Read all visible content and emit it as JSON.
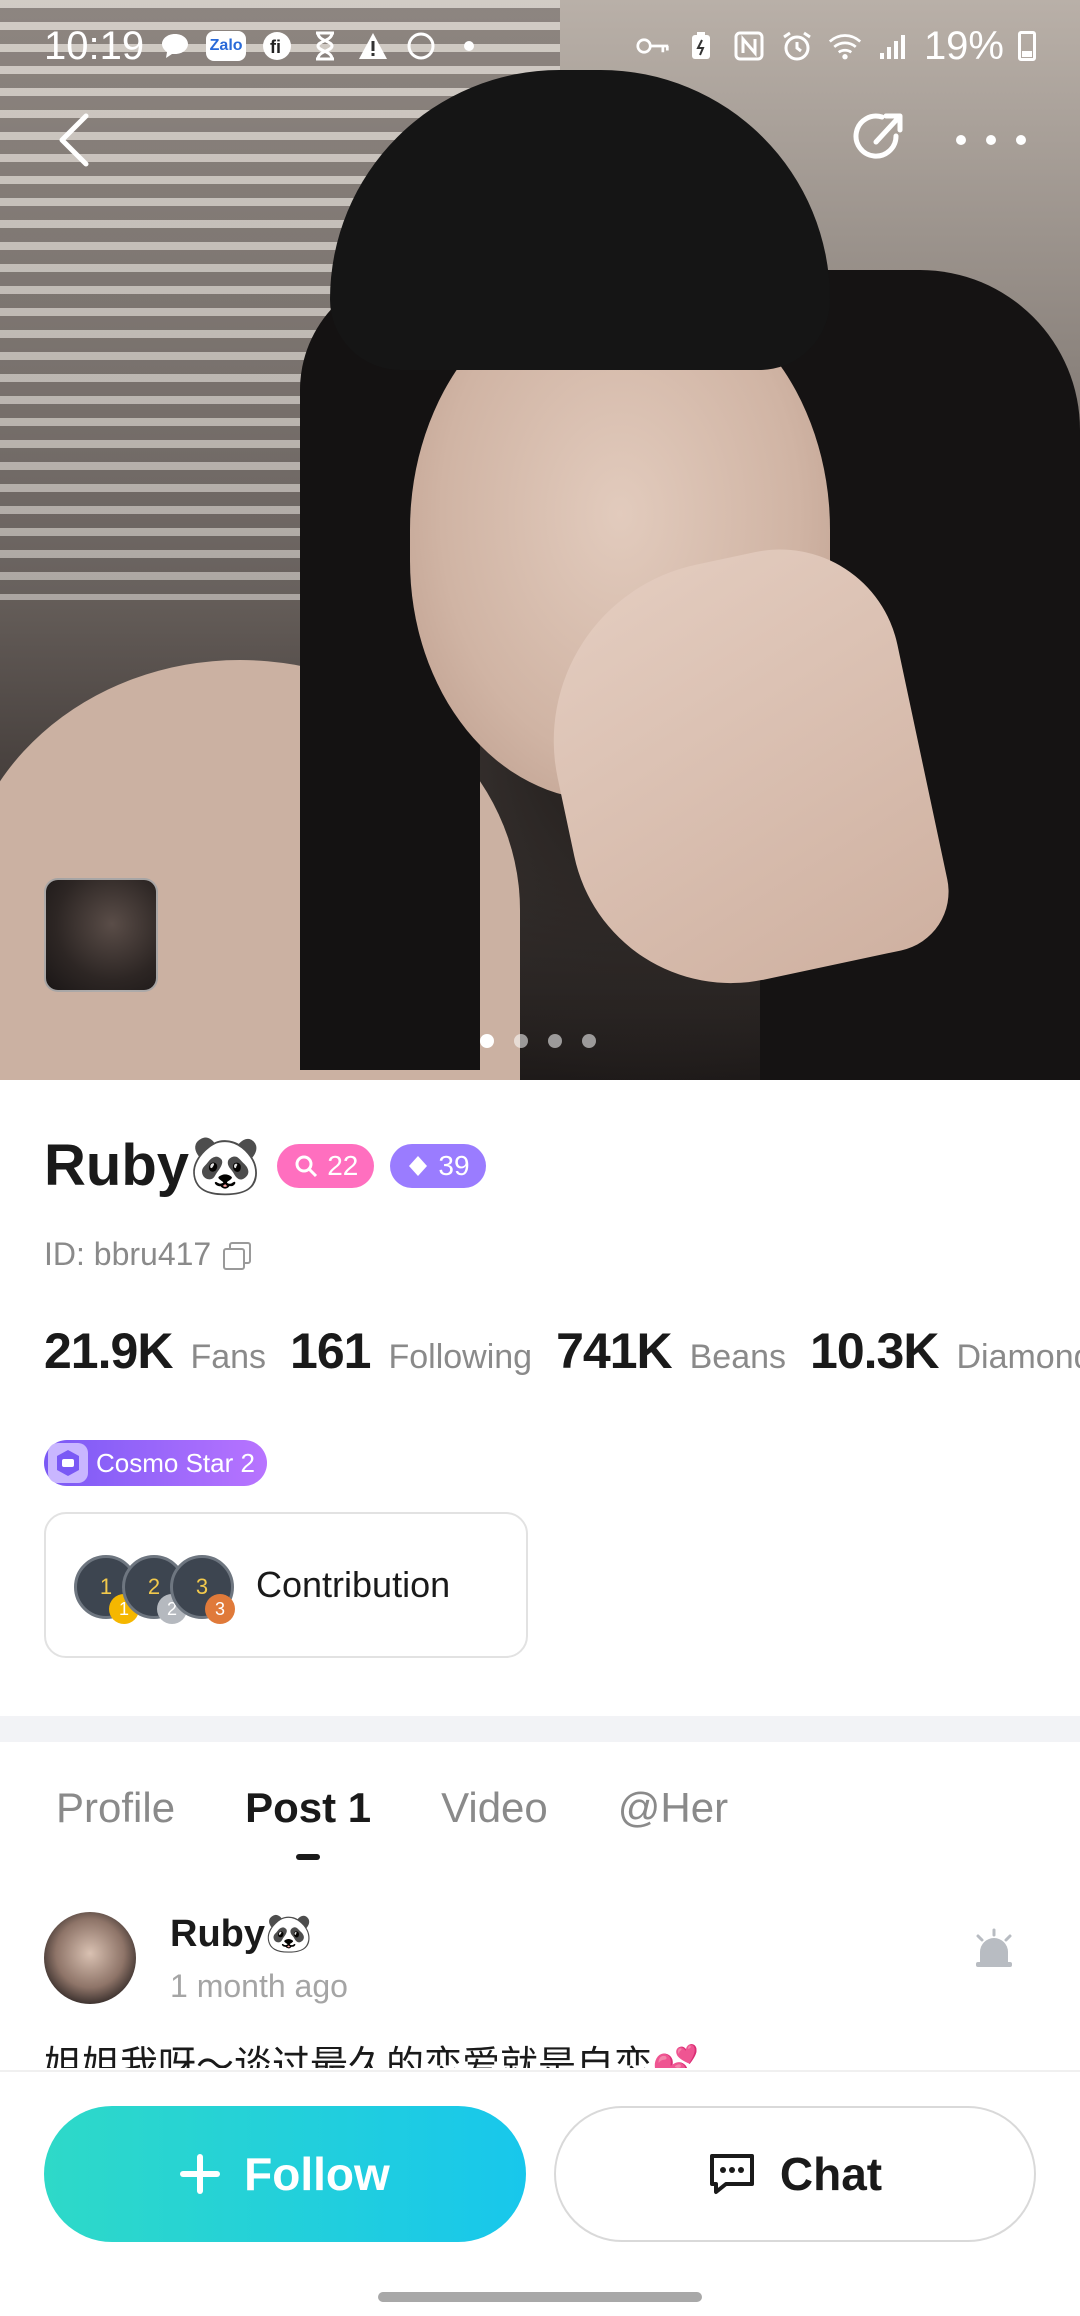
{
  "status_bar": {
    "time": "10:19",
    "zalo_label": "Zalo",
    "battery": "19%",
    "left_icons": [
      "chat-bubble-icon",
      "zalo-icon",
      "fi-icon",
      "hourglass-icon",
      "warning-icon",
      "moon-icon",
      "dot-icon"
    ],
    "right_icons": [
      "key-icon",
      "battery-saver-icon",
      "nfc-icon",
      "alarm-icon",
      "wifi-icon",
      "signal-icon"
    ]
  },
  "gallery": {
    "total_photos": 4,
    "active_index": 0
  },
  "profile": {
    "name": "Ruby🐼",
    "badge_level": "22",
    "badge_diamond": "39",
    "id_text": "ID: bbru417",
    "stats": [
      {
        "value": "21.9K",
        "label": "Fans"
      },
      {
        "value": "161",
        "label": "Following"
      },
      {
        "value": "741K",
        "label": "Beans"
      },
      {
        "value": "10.3K",
        "label": "Diamonds"
      }
    ],
    "cosmo_label": "Cosmo Star 2",
    "contribution_label": "Contribution",
    "medals": [
      "1",
      "2",
      "3"
    ]
  },
  "tabs": [
    {
      "label": "Profile",
      "active": false
    },
    {
      "label": "Post 1",
      "active": true
    },
    {
      "label": "Video",
      "active": false
    },
    {
      "label": "@Her",
      "active": false
    }
  ],
  "post": {
    "author": "Ruby🐼",
    "time": "1 month ago",
    "text": "姐姐我呀～谈过最久的恋爱就是自恋💕"
  },
  "actions": {
    "follow_label": "Follow",
    "chat_label": "Chat"
  },
  "colors": {
    "follow_gradient_start": "#2ed9c8",
    "follow_gradient_end": "#18c7ec",
    "badge_pink": "#ff6fbf",
    "badge_purple": "#9a7cff",
    "cosmo_purple": "#7a59f5"
  }
}
